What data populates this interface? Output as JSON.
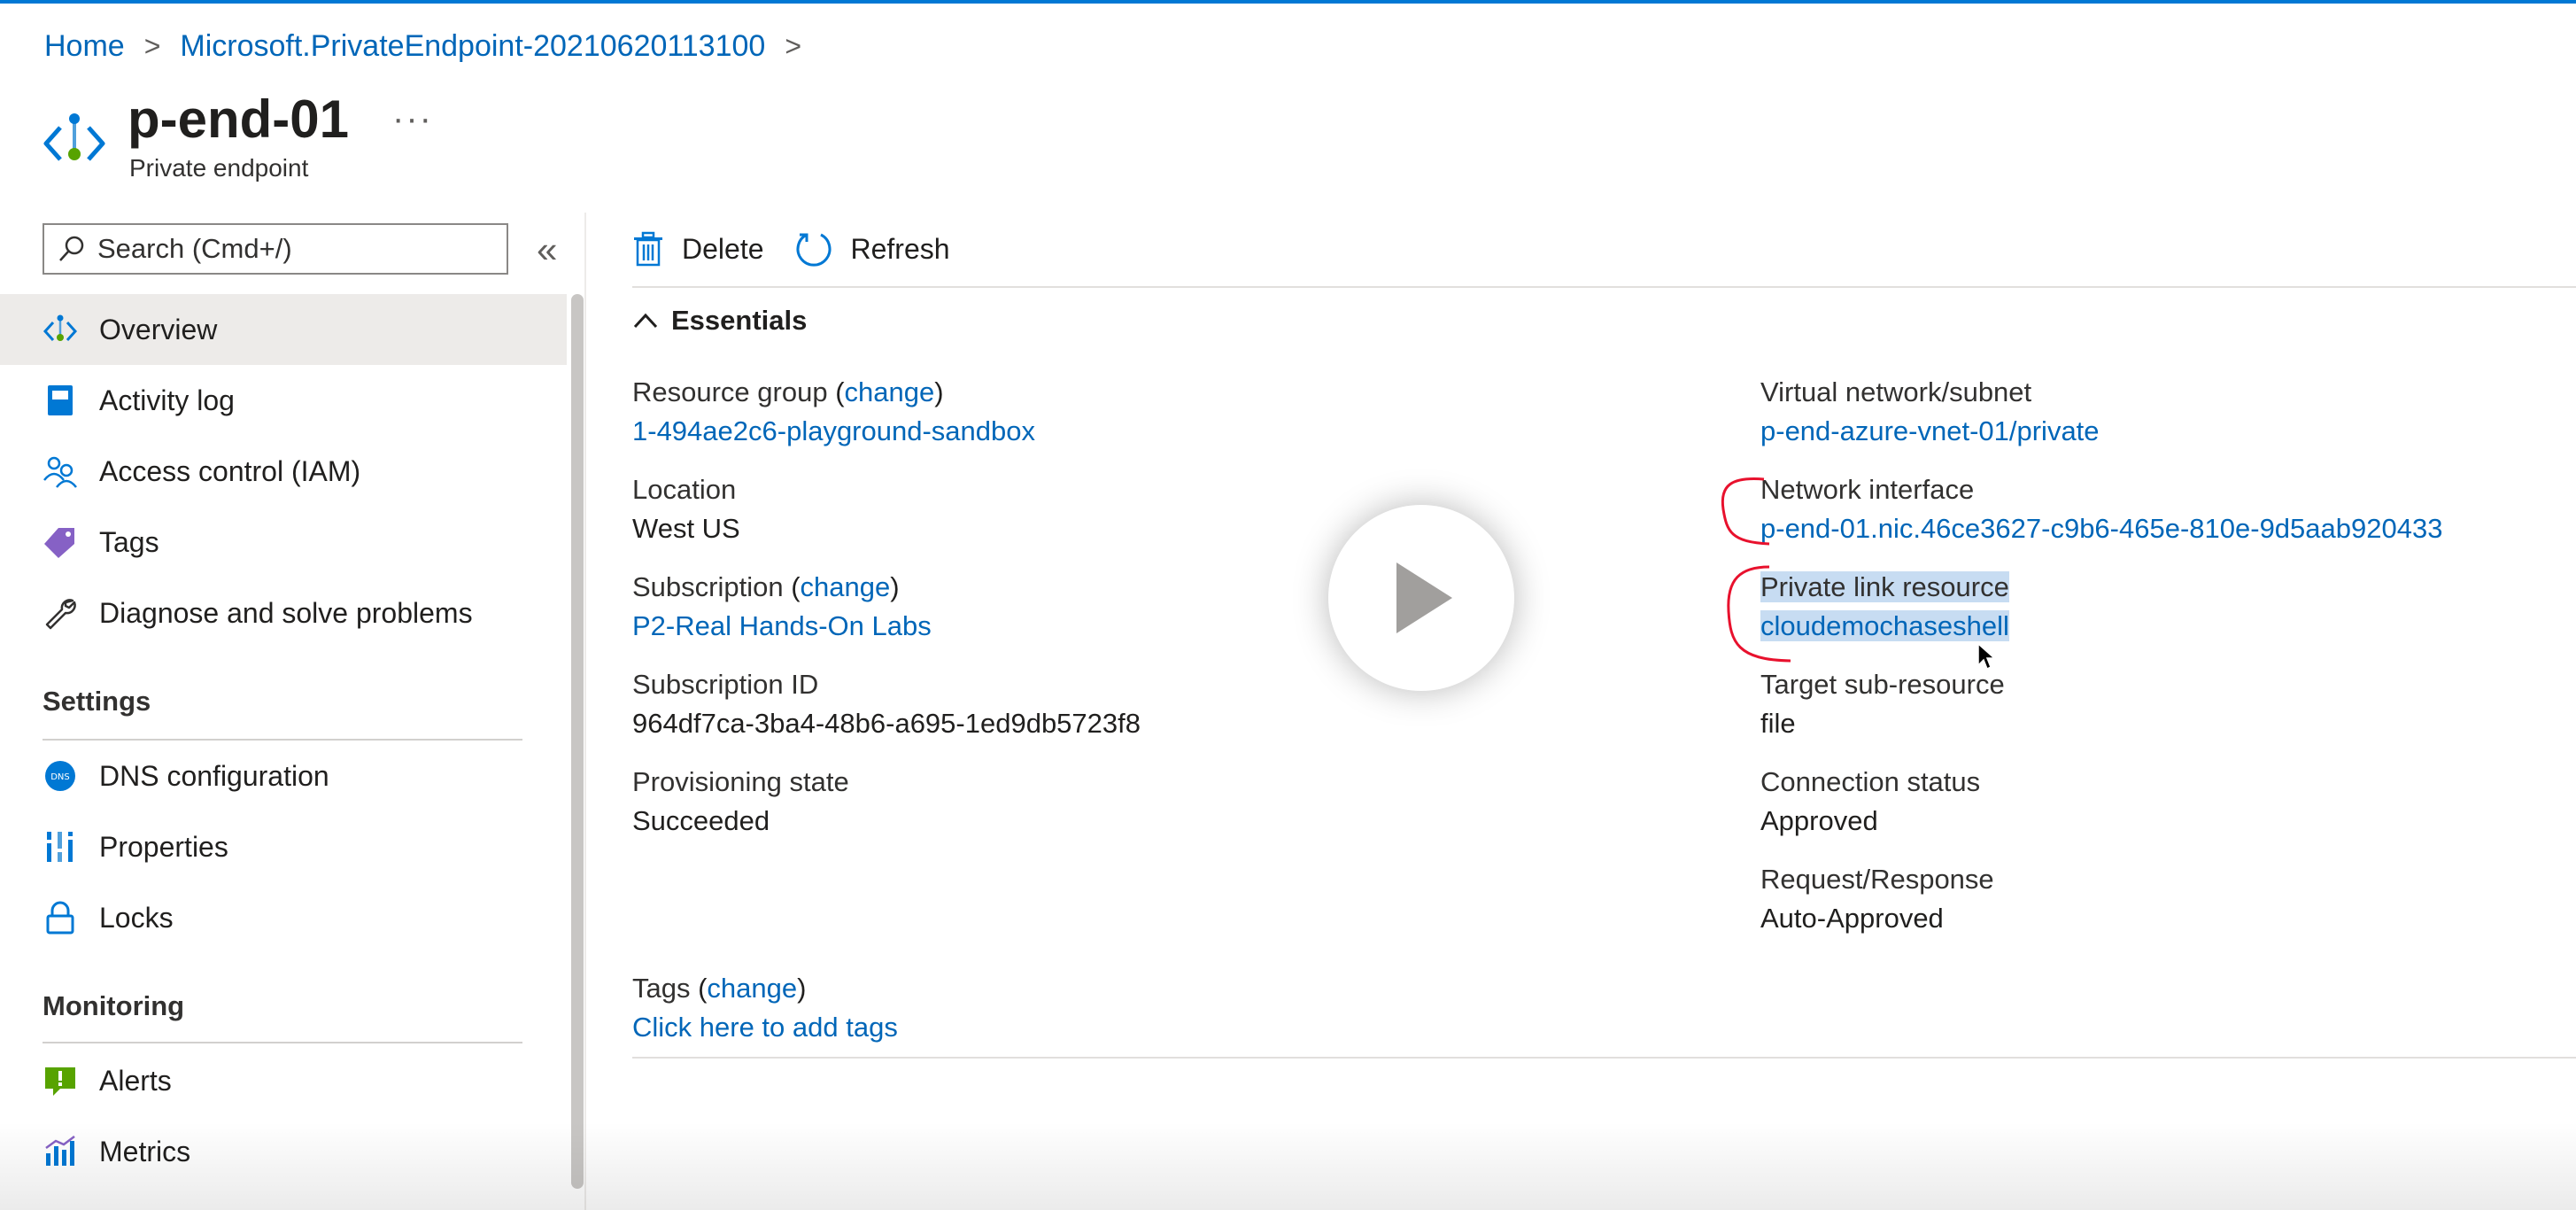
{
  "breadcrumb": {
    "items": [
      {
        "label": "Home"
      },
      {
        "label": "Microsoft.PrivateEndpoint-20210620113100"
      }
    ]
  },
  "header": {
    "title": "p-end-01",
    "subtitle": "Private endpoint",
    "more": "···"
  },
  "search": {
    "placeholder": "Search (Cmd+/)"
  },
  "sidebar": {
    "collapse": "«",
    "items": [
      {
        "label": "Overview"
      },
      {
        "label": "Activity log"
      },
      {
        "label": "Access control (IAM)"
      },
      {
        "label": "Tags"
      },
      {
        "label": "Diagnose and solve problems"
      }
    ],
    "settings": {
      "title": "Settings",
      "items": [
        {
          "label": "DNS configuration"
        },
        {
          "label": "Properties"
        },
        {
          "label": "Locks"
        }
      ]
    },
    "monitoring": {
      "title": "Monitoring",
      "items": [
        {
          "label": "Alerts"
        },
        {
          "label": "Metrics"
        }
      ]
    }
  },
  "toolbar": {
    "delete_label": "Delete",
    "refresh_label": "Refresh"
  },
  "essentials": {
    "title": "Essentials",
    "change": "change",
    "left": {
      "resource_group": {
        "label": "Resource group",
        "value": "1-494ae2c6-playground-sandbox"
      },
      "location": {
        "label": "Location",
        "value": "West US"
      },
      "subscription": {
        "label": "Subscription",
        "value": "P2-Real Hands-On Labs"
      },
      "subscription_id": {
        "label": "Subscription ID",
        "value": "964df7ca-3ba4-48b6-a695-1ed9db5723f8"
      },
      "provisioning_state": {
        "label": "Provisioning state",
        "value": "Succeeded"
      }
    },
    "right": {
      "vnet_subnet": {
        "label": "Virtual network/subnet",
        "value": "p-end-azure-vnet-01/private"
      },
      "network_interface": {
        "label": "Network interface",
        "value": "p-end-01.nic.46ce3627-c9b6-465e-810e-9d5aab920433"
      },
      "private_link_resource": {
        "label": "Private link resource",
        "value": "cloudemochaseshell"
      },
      "target_sub_resource": {
        "label": "Target sub-resource",
        "value": "file"
      },
      "connection_status": {
        "label": "Connection status",
        "value": "Approved"
      },
      "request_response": {
        "label": "Request/Response",
        "value": "Auto-Approved"
      }
    },
    "tags": {
      "label": "Tags",
      "value": "Click here to add tags"
    }
  },
  "colors": {
    "accent": "#0078d4",
    "link": "#0066b8",
    "selection_highlight": "#c7dcf2",
    "annotation": "#e8112d"
  }
}
